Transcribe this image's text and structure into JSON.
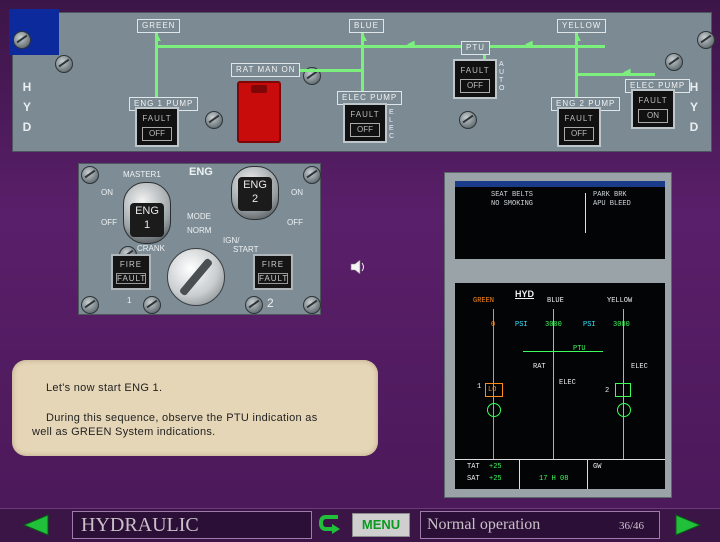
{
  "hyd_panel": {
    "systems": {
      "green": "GREEN",
      "blue": "BLUE",
      "yellow": "YELLOW"
    },
    "hyd_letters": [
      "H",
      "Y",
      "D"
    ],
    "labels": {
      "ptu": "PTU",
      "rat_man_on": "RAT MAN ON",
      "elec_pump_blue": "ELEC PUMP",
      "elec_pump_yellow": "ELEC PUMP",
      "eng1_pump": "ENG 1 PUMP",
      "eng2_pump": "ENG 2 PUMP",
      "auto": "AUTO",
      "elec": "ELEC"
    },
    "buttons": {
      "eng1_pump": {
        "fault": "FAULT",
        "state": "OFF"
      },
      "elec_pump_blue": {
        "fault": "FAULT",
        "state": "OFF"
      },
      "ptu": {
        "fault": "FAULT",
        "state": "OFF"
      },
      "eng2_pump": {
        "fault": "FAULT",
        "state": "OFF"
      },
      "elec_pump_yellow": {
        "fault": "FAULT",
        "state": "ON"
      }
    }
  },
  "eng_panel": {
    "title": "ENG",
    "master1": "MASTER1",
    "on": "ON",
    "off": "OFF",
    "eng1": "ENG\n1",
    "eng1_line1": "ENG",
    "eng1_line2": "1",
    "eng2_line1": "ENG",
    "eng2_line2": "2",
    "mode": "MODE",
    "norm": "NORM",
    "crank": "CRANK",
    "ign_start": "IGN/\nSTART",
    "ign": "IGN/",
    "start": "START",
    "fire": "FIRE",
    "fault": "FAULT",
    "num1": "1",
    "num2": "2"
  },
  "ecam": {
    "upper": {
      "left1": "SEAT BELTS",
      "left2": "NO SMOKING",
      "right1": "PARK BRK",
      "right2": "APU BLEED"
    },
    "lower": {
      "title": "HYD",
      "green": "GREEN",
      "blue": "BLUE",
      "yellow": "YELLOW",
      "g_psi": "0",
      "b_psi": "3000",
      "y_psi": "3000",
      "psi1": "PSI",
      "psi2": "PSI",
      "ptu": "PTU",
      "rat": "RAT",
      "elec_blue": "ELEC",
      "elec_yellow": "ELEC",
      "lo": "LO",
      "num1": "1",
      "num2": "2",
      "tat_label": "TAT",
      "tat_value": "+25",
      "sat_label": "SAT",
      "sat_value": "+25",
      "time": "17 H 08",
      "gw": "GW"
    }
  },
  "info_box": {
    "line1": "Let's now start ENG 1.",
    "line2": "During this sequence, observe the PTU indication as",
    "line3": "well as GREEN System indications."
  },
  "navbar": {
    "title": "HYDRAULIC",
    "menu": "MENU",
    "subtitle": "Normal operation",
    "page": "36/46"
  },
  "colors": {
    "green_line": "#7cf07c",
    "ecam_green": "#3dff5a",
    "ecam_amber": "#ff8a1e",
    "ecam_cyan": "#38e4ff",
    "rat_red": "#c80c0c"
  }
}
